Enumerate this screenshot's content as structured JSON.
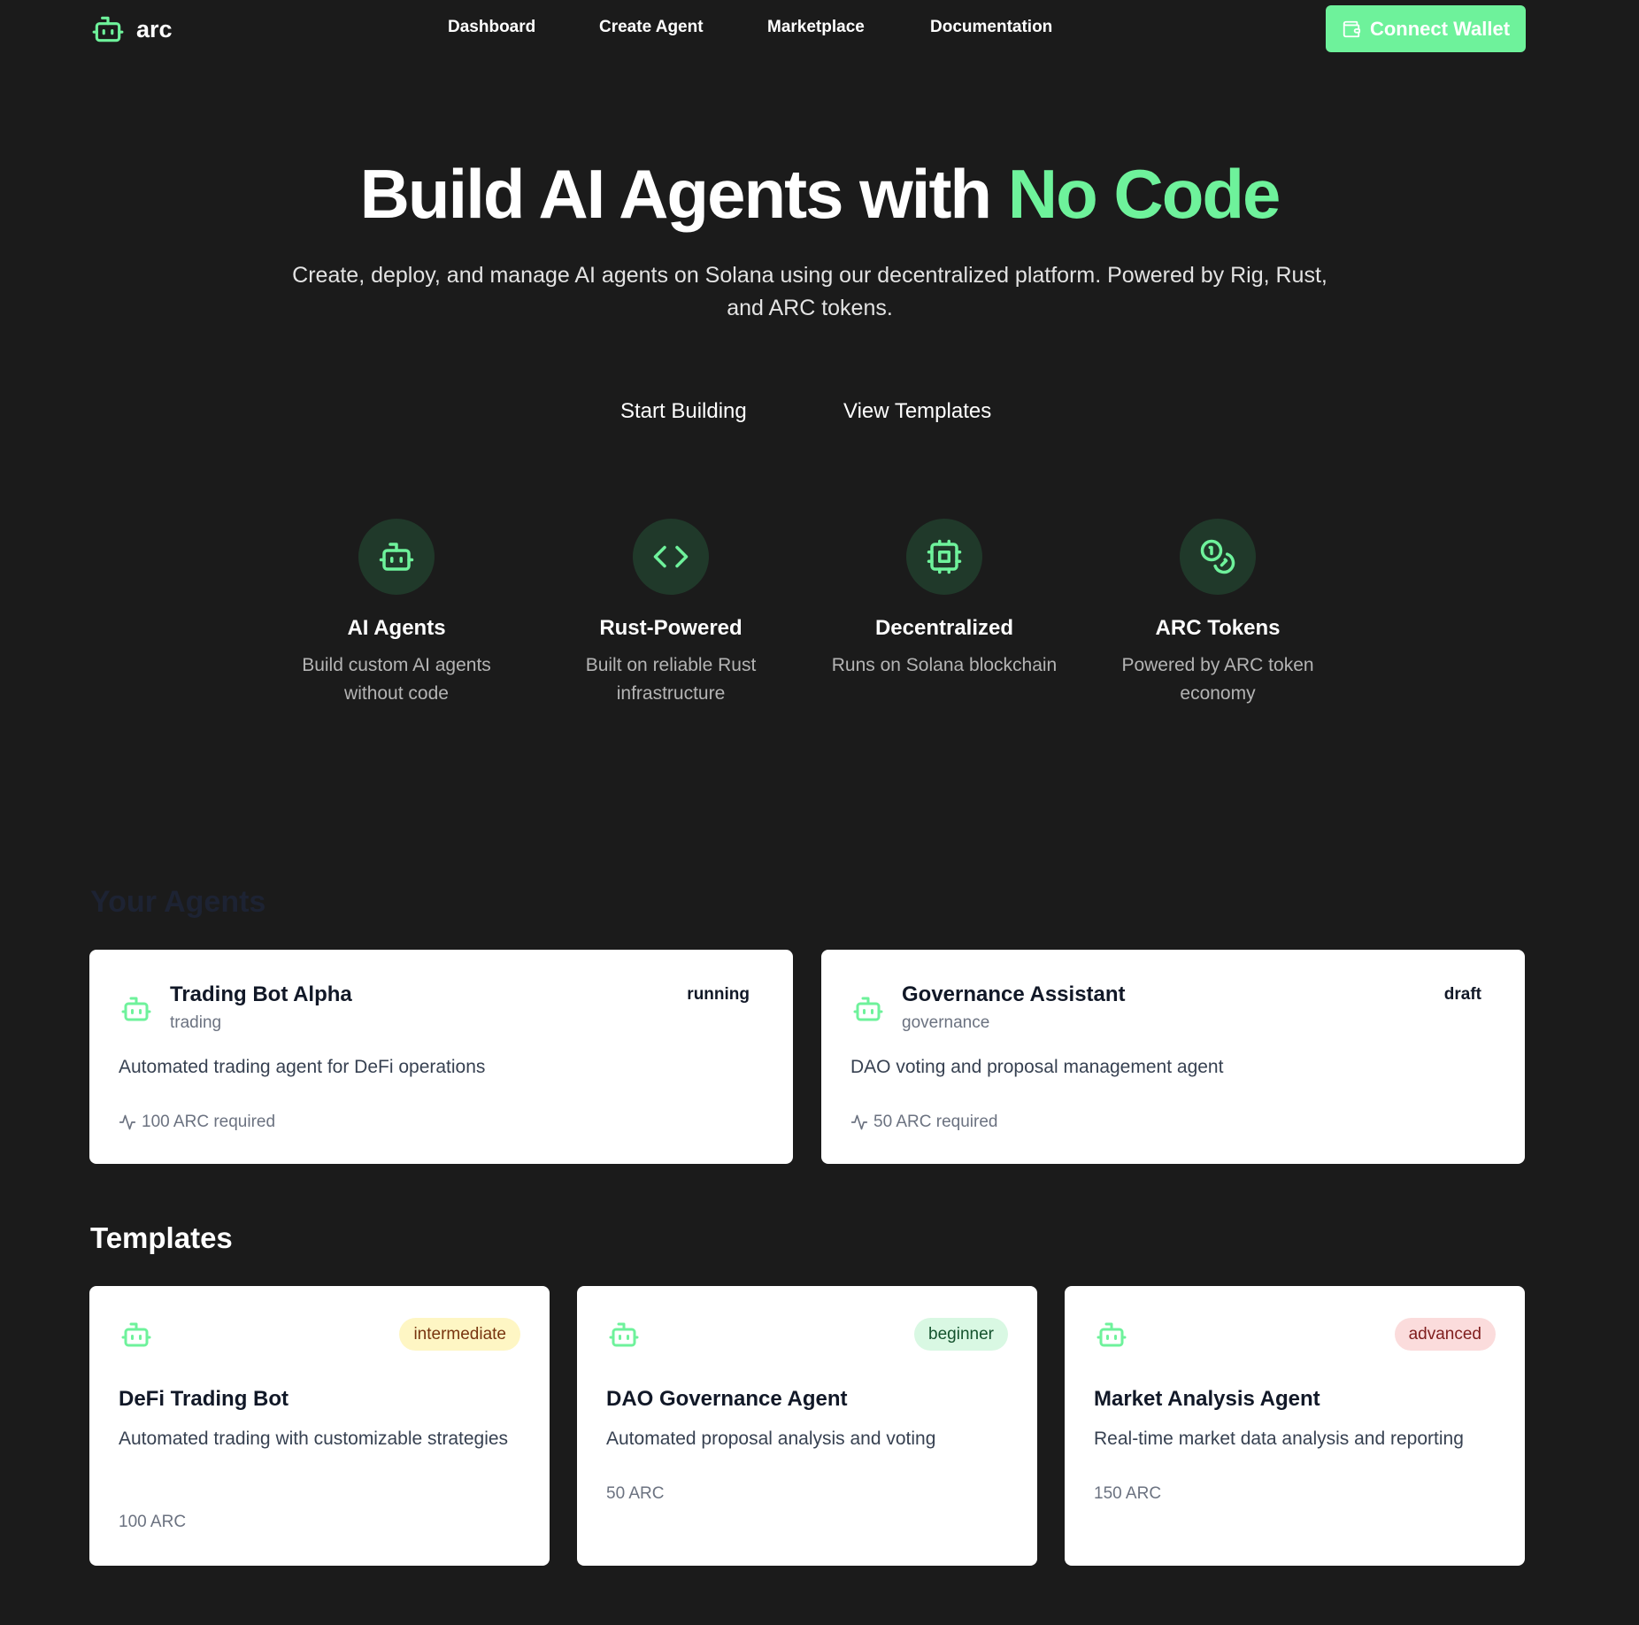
{
  "brand": {
    "name": "arc",
    "icon": "robot-icon",
    "accent": "#6ef29b"
  },
  "nav": {
    "links": [
      "Dashboard",
      "Create Agent",
      "Marketplace",
      "Documentation"
    ],
    "wallet_button": "Connect Wallet",
    "wallet_icon": "wallet-icon"
  },
  "hero": {
    "title_main": "Build AI Agents with",
    "title_accent": "No Code",
    "subtitle": "Create, deploy, and manage AI agents on Solana using our decentralized platform. Powered by Rig, Rust, and ARC tokens.",
    "primary_cta": "Start Building",
    "secondary_cta": "View Templates"
  },
  "features": [
    {
      "icon": "robot-icon",
      "title": "AI Agents",
      "desc": "Build custom AI agents without code"
    },
    {
      "icon": "code-icon",
      "title": "Rust-Powered",
      "desc": "Built on reliable Rust infrastructure"
    },
    {
      "icon": "cpu-icon",
      "title": "Decentralized",
      "desc": "Runs on Solana blockchain"
    },
    {
      "icon": "coins-icon",
      "title": "ARC Tokens",
      "desc": "Powered by ARC token economy"
    }
  ],
  "agents_section": {
    "heading": "Your Agents",
    "agents": [
      {
        "name": "Trading Bot Alpha",
        "category": "trading",
        "status": "running",
        "description": "Automated trading agent for DeFi operations",
        "requirement": "100 ARC required"
      },
      {
        "name": "Governance Assistant",
        "category": "governance",
        "status": "draft",
        "description": "DAO voting and proposal management agent",
        "requirement": "50 ARC required"
      }
    ]
  },
  "templates_section": {
    "heading": "Templates",
    "templates": [
      {
        "name": "DeFi Trading Bot",
        "level": "intermediate",
        "description": "Automated trading with customizable strategies",
        "price": "100 ARC"
      },
      {
        "name": "DAO Governance Agent",
        "level": "beginner",
        "description": "Automated proposal analysis and voting",
        "price": "50 ARC"
      },
      {
        "name": "Market Analysis Agent",
        "level": "advanced",
        "description": "Real-time market data analysis and reporting",
        "price": "150 ARC"
      }
    ]
  }
}
